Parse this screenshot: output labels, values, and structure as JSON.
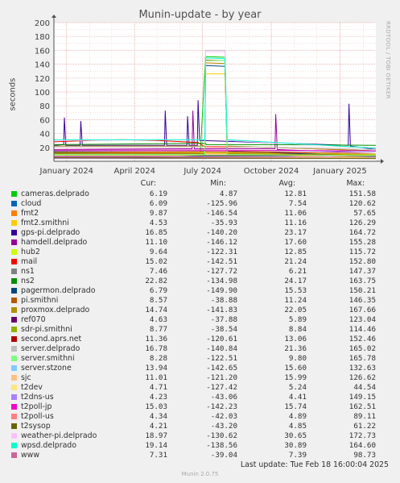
{
  "title": "Munin-update - by year",
  "side_credit": "RRDTOOL / TOBI OETIKER",
  "legend_headers": {
    "cur": "Cur:",
    "min": "Min:",
    "avg": "Avg:",
    "max": "Max:"
  },
  "last_update": "Last update: Tue Feb 18 16:00:04 2025",
  "version": "Munin 2.0.75",
  "chart_data": {
    "type": "line",
    "title": "Munin-update - by year",
    "ylabel": "seconds",
    "ylim": [
      0,
      200
    ],
    "yticks": [
      20,
      40,
      60,
      80,
      100,
      120,
      140,
      160,
      180,
      200
    ],
    "xlim": [
      "2023-12-15",
      "2025-02-18"
    ],
    "xticks": [
      {
        "label": "January 2024",
        "date": "2024-01-01"
      },
      {
        "label": "April 2024",
        "date": "2024-04-01"
      },
      {
        "label": "July 2024",
        "date": "2024-07-01"
      },
      {
        "label": "October 2024",
        "date": "2024-10-01"
      },
      {
        "label": "January 2025",
        "date": "2025-01-01"
      }
    ],
    "grid": true,
    "series": [
      {
        "name": "cameras.delprado",
        "color": "#00cc00",
        "cur": "6.19",
        "min": "4.87",
        "avg": "12.81",
        "max": "151.58",
        "points": [
          [
            "2023-12-15",
            12
          ],
          [
            "2024-03-01",
            12
          ],
          [
            "2024-06-28",
            12
          ],
          [
            "2024-07-05",
            151
          ],
          [
            "2024-07-31",
            150
          ],
          [
            "2024-08-03",
            15
          ],
          [
            "2024-10-01",
            14
          ],
          [
            "2025-02-18",
            10
          ]
        ]
      },
      {
        "name": "cloud",
        "color": "#0066b3",
        "cur": "6.09",
        "min": "-125.96",
        "avg": "7.54",
        "max": "120.62",
        "points": [
          [
            "2023-12-15",
            7
          ],
          [
            "2024-06-01",
            7
          ],
          [
            "2024-07-05",
            8
          ],
          [
            "2024-10-01",
            8
          ],
          [
            "2025-02-18",
            6
          ]
        ]
      },
      {
        "name": "fmt2",
        "color": "#ff8000",
        "cur": "9.87",
        "min": "-146.54",
        "avg": "11.06",
        "max": "57.65",
        "points": [
          [
            "2023-12-15",
            11
          ],
          [
            "2024-05-01",
            12
          ],
          [
            "2024-09-01",
            11
          ],
          [
            "2025-02-18",
            10
          ]
        ]
      },
      {
        "name": "fmt2.smithni",
        "color": "#ffcc00",
        "cur": "4.53",
        "min": "-35.93",
        "avg": "11.16",
        "max": "126.29",
        "points": [
          [
            "2023-12-15",
            11
          ],
          [
            "2024-05-01",
            11
          ],
          [
            "2024-07-04",
            11
          ],
          [
            "2024-07-05",
            126
          ],
          [
            "2024-07-31",
            126
          ],
          [
            "2024-08-03",
            11
          ],
          [
            "2025-02-18",
            5
          ]
        ]
      },
      {
        "name": "gps-pi.delprado",
        "color": "#330099",
        "cur": "16.85",
        "min": "-140.20",
        "avg": "23.17",
        "max": "164.72",
        "points": [
          [
            "2023-12-15",
            23
          ],
          [
            "2023-12-28",
            24
          ],
          [
            "2023-12-29",
            63
          ],
          [
            "2023-12-31",
            23
          ],
          [
            "2024-01-19",
            23
          ],
          [
            "2024-01-20",
            58
          ],
          [
            "2024-01-22",
            23
          ],
          [
            "2024-05-11",
            23
          ],
          [
            "2024-05-12",
            73
          ],
          [
            "2024-05-14",
            23
          ],
          [
            "2024-06-10",
            23
          ],
          [
            "2024-06-11",
            65
          ],
          [
            "2024-06-13",
            23
          ],
          [
            "2024-06-24",
            23
          ],
          [
            "2024-06-25",
            88
          ],
          [
            "2024-06-27",
            30
          ],
          [
            "2025-01-12",
            23
          ],
          [
            "2025-01-13",
            83
          ],
          [
            "2025-01-15",
            22
          ],
          [
            "2025-02-18",
            17
          ]
        ]
      },
      {
        "name": "hamdell.delprado",
        "color": "#990099",
        "cur": "11.10",
        "min": "-146.12",
        "avg": "17.60",
        "max": "155.28",
        "points": [
          [
            "2023-12-15",
            17
          ],
          [
            "2024-06-01",
            18
          ],
          [
            "2024-06-17",
            18
          ],
          [
            "2024-06-18",
            73
          ],
          [
            "2024-06-20",
            18
          ],
          [
            "2024-10-06",
            18
          ],
          [
            "2024-10-07",
            68
          ],
          [
            "2024-10-09",
            17
          ],
          [
            "2025-02-18",
            11
          ]
        ]
      },
      {
        "name": "hub2",
        "color": "#ccff00",
        "cur": "9.64",
        "min": "-122.31",
        "avg": "12.85",
        "max": "115.72",
        "points": [
          [
            "2023-12-15",
            13
          ],
          [
            "2024-06-01",
            13
          ],
          [
            "2024-09-01",
            12
          ],
          [
            "2025-02-18",
            10
          ]
        ]
      },
      {
        "name": "mail",
        "color": "#ff0000",
        "cur": "15.02",
        "min": "-142.51",
        "avg": "21.24",
        "max": "152.80",
        "points": [
          [
            "2023-12-15",
            28
          ],
          [
            "2024-02-01",
            30
          ],
          [
            "2024-03-15",
            31
          ],
          [
            "2024-05-01",
            30
          ],
          [
            "2024-06-25",
            27
          ],
          [
            "2024-07-04",
            21
          ],
          [
            "2024-10-01",
            20
          ],
          [
            "2025-02-18",
            15
          ]
        ]
      },
      {
        "name": "ns1",
        "color": "#808080",
        "cur": "7.46",
        "min": "-127.72",
        "avg": "6.21",
        "max": "147.37",
        "points": [
          [
            "2023-12-15",
            6
          ],
          [
            "2024-07-05",
            7
          ],
          [
            "2025-02-18",
            7
          ]
        ]
      },
      {
        "name": "ns2",
        "color": "#008f00",
        "cur": "22.82",
        "min": "-134.98",
        "avg": "24.17",
        "max": "163.75",
        "points": [
          [
            "2023-12-15",
            24
          ],
          [
            "2024-04-01",
            25
          ],
          [
            "2024-07-05",
            26
          ],
          [
            "2024-07-06",
            24
          ],
          [
            "2024-10-01",
            24
          ],
          [
            "2025-02-18",
            23
          ]
        ]
      },
      {
        "name": "pagermon.delprado",
        "color": "#00487d",
        "cur": "6.79",
        "min": "-149.90",
        "avg": "15.53",
        "max": "150.21",
        "points": [
          [
            "2023-12-15",
            15
          ],
          [
            "2024-07-04",
            16
          ],
          [
            "2024-07-05",
            138
          ],
          [
            "2024-07-31",
            137
          ],
          [
            "2024-08-03",
            15
          ],
          [
            "2025-02-18",
            7
          ]
        ]
      },
      {
        "name": "pi.smithni",
        "color": "#b35a00",
        "cur": "8.57",
        "min": "-38.88",
        "avg": "11.24",
        "max": "146.35",
        "points": [
          [
            "2023-12-15",
            11
          ],
          [
            "2024-07-04",
            11
          ],
          [
            "2024-07-05",
            146
          ],
          [
            "2024-07-31",
            145
          ],
          [
            "2024-08-03",
            11
          ],
          [
            "2025-02-18",
            9
          ]
        ]
      },
      {
        "name": "proxmox.delprado",
        "color": "#b38f00",
        "cur": "14.74",
        "min": "-141.83",
        "avg": "22.05",
        "max": "167.66",
        "points": [
          [
            "2023-12-15",
            22
          ],
          [
            "2024-07-04",
            22
          ],
          [
            "2024-07-05",
            142
          ],
          [
            "2024-07-31",
            141
          ],
          [
            "2024-08-03",
            22
          ],
          [
            "2025-02-18",
            15
          ]
        ]
      },
      {
        "name": "ref070",
        "color": "#6b006b",
        "cur": "4.63",
        "min": "-37.88",
        "avg": "5.89",
        "max": "123.04",
        "points": [
          [
            "2023-12-15",
            6
          ],
          [
            "2025-02-18",
            5
          ]
        ]
      },
      {
        "name": "sdr-pi.smithni",
        "color": "#8fb300",
        "cur": "8.77",
        "min": "-38.54",
        "avg": "8.84",
        "max": "114.46",
        "points": [
          [
            "2023-12-15",
            9
          ],
          [
            "2025-02-18",
            9
          ]
        ]
      },
      {
        "name": "second.aprs.net",
        "color": "#b30000",
        "cur": "11.36",
        "min": "-120.61",
        "avg": "13.06",
        "max": "152.46",
        "points": [
          [
            "2023-12-15",
            13
          ],
          [
            "2024-07-05",
            14
          ],
          [
            "2025-02-18",
            11
          ]
        ]
      },
      {
        "name": "server.delprado",
        "color": "#bebebe",
        "cur": "16.78",
        "min": "-140.84",
        "avg": "21.36",
        "max": "165.02",
        "points": [
          [
            "2023-12-15",
            21
          ],
          [
            "2024-07-04",
            21
          ],
          [
            "2024-07-05",
            160
          ],
          [
            "2024-07-31",
            160
          ],
          [
            "2024-08-03",
            21
          ],
          [
            "2025-02-18",
            17
          ]
        ]
      },
      {
        "name": "server.smithni",
        "color": "#80ff80",
        "cur": "8.28",
        "min": "-122.51",
        "avg": "9.80",
        "max": "165.78",
        "points": [
          [
            "2023-12-15",
            10
          ],
          [
            "2024-07-04",
            10
          ],
          [
            "2024-07-05",
            145
          ],
          [
            "2024-07-31",
            145
          ],
          [
            "2024-08-03",
            10
          ],
          [
            "2025-02-18",
            8
          ]
        ]
      },
      {
        "name": "server.stzone",
        "color": "#80c9ff",
        "cur": "13.94",
        "min": "-142.65",
        "avg": "15.60",
        "max": "132.63",
        "points": [
          [
            "2023-12-15",
            16
          ],
          [
            "2024-07-05",
            16
          ],
          [
            "2025-02-18",
            14
          ]
        ]
      },
      {
        "name": "sjc",
        "color": "#ffc080",
        "cur": "11.01",
        "min": "-121.20",
        "avg": "15.99",
        "max": "126.62",
        "points": [
          [
            "2023-12-15",
            16
          ],
          [
            "2024-07-05",
            16
          ],
          [
            "2025-02-18",
            11
          ]
        ]
      },
      {
        "name": "t2dev",
        "color": "#ffe680",
        "cur": "4.71",
        "min": "-127.42",
        "avg": "5.24",
        "max": "44.54",
        "points": [
          [
            "2023-12-15",
            5
          ],
          [
            "2025-02-18",
            5
          ]
        ]
      },
      {
        "name": "t2dns-us",
        "color": "#aa80ff",
        "cur": "4.23",
        "min": "-43.06",
        "avg": "4.41",
        "max": "149.15",
        "points": [
          [
            "2023-12-15",
            4
          ],
          [
            "2025-02-18",
            4
          ]
        ]
      },
      {
        "name": "t2poll-jp",
        "color": "#ee00cc",
        "cur": "15.03",
        "min": "-142.23",
        "avg": "15.74",
        "max": "162.51",
        "points": [
          [
            "2023-12-15",
            16
          ],
          [
            "2024-07-05",
            16
          ],
          [
            "2025-02-18",
            15
          ]
        ]
      },
      {
        "name": "t2poll-us",
        "color": "#ff8080",
        "cur": "4.34",
        "min": "-42.03",
        "avg": "4.89",
        "max": "89.11",
        "points": [
          [
            "2023-12-15",
            5
          ],
          [
            "2025-02-18",
            4
          ]
        ]
      },
      {
        "name": "t2sysop",
        "color": "#666600",
        "cur": "4.21",
        "min": "-43.20",
        "avg": "4.85",
        "max": "61.22",
        "points": [
          [
            "2023-12-15",
            5
          ],
          [
            "2025-02-18",
            4
          ]
        ]
      },
      {
        "name": "weather-pi.delprado",
        "color": "#ffbfff",
        "cur": "18.97",
        "min": "-130.62",
        "avg": "30.65",
        "max": "172.73",
        "points": [
          [
            "2023-12-15",
            30
          ],
          [
            "2024-07-04",
            31
          ],
          [
            "2024-07-05",
            158
          ],
          [
            "2024-07-31",
            158
          ],
          [
            "2024-08-03",
            30
          ],
          [
            "2025-02-18",
            19
          ]
        ]
      },
      {
        "name": "wpsd.delprado",
        "color": "#00ffcc",
        "cur": "19.14",
        "min": "-138.56",
        "avg": "30.89",
        "max": "164.60",
        "points": [
          [
            "2023-12-15",
            31
          ],
          [
            "2024-07-04",
            31
          ],
          [
            "2024-07-05",
            149
          ],
          [
            "2024-07-31",
            148
          ],
          [
            "2024-08-03",
            31
          ],
          [
            "2025-02-18",
            19
          ]
        ]
      },
      {
        "name": "www",
        "color": "#cc6699",
        "cur": "7.31",
        "min": "-39.04",
        "avg": "7.39",
        "max": "98.73",
        "points": [
          [
            "2023-12-15",
            7
          ],
          [
            "2025-02-18",
            7
          ]
        ]
      }
    ]
  }
}
